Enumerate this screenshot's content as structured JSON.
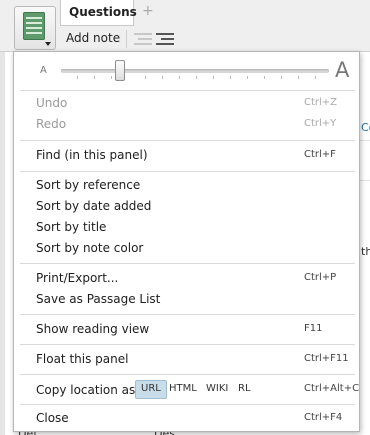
{
  "toolbar": {
    "tabs": [
      {
        "label": "Questions"
      }
    ],
    "add_tab_symbol": "+",
    "add_note_label": "Add note"
  },
  "background": {
    "right_fragment_1": "Co",
    "right_fragment_2": "th",
    "bottom_fragment_1": "Def",
    "bottom_fragment_2": "Des"
  },
  "zoom": {
    "small_label": "A",
    "large_label": "A",
    "level": 0.22
  },
  "menu": {
    "undo": {
      "label": "Undo",
      "shortcut": "Ctrl+Z",
      "enabled": false
    },
    "redo": {
      "label": "Redo",
      "shortcut": "Ctrl+Y",
      "enabled": false
    },
    "find": {
      "label": "Find (in this panel)",
      "shortcut": "Ctrl+F"
    },
    "sort_reference": {
      "label": "Sort by reference"
    },
    "sort_date": {
      "label": "Sort by date added"
    },
    "sort_title": {
      "label": "Sort by title"
    },
    "sort_color": {
      "label": "Sort by note color"
    },
    "print_export": {
      "label": "Print/Export...",
      "shortcut": "Ctrl+P"
    },
    "save_passage": {
      "label": "Save as Passage List"
    },
    "reading_view": {
      "label": "Show reading view",
      "shortcut": "F11"
    },
    "float_panel": {
      "label": "Float this panel",
      "shortcut": "Ctrl+F11"
    },
    "copy_location": {
      "label": "Copy location as:",
      "options": [
        "URL",
        "HTML",
        "WIKI",
        "RL"
      ],
      "selected": "URL",
      "shortcut": "Ctrl+Alt+C"
    },
    "close": {
      "label": "Close",
      "shortcut": "Ctrl+F4"
    }
  },
  "colors": {
    "menu_background": "#ffffff",
    "disabled_text": "#9a9a9a",
    "selected_option": "#c8dcea",
    "panel_icon": "#5e9a6c"
  },
  "icons": [
    "panel-menu-icon",
    "dropdown-caret-icon",
    "list-outdent-icon",
    "list-indent-icon"
  ]
}
